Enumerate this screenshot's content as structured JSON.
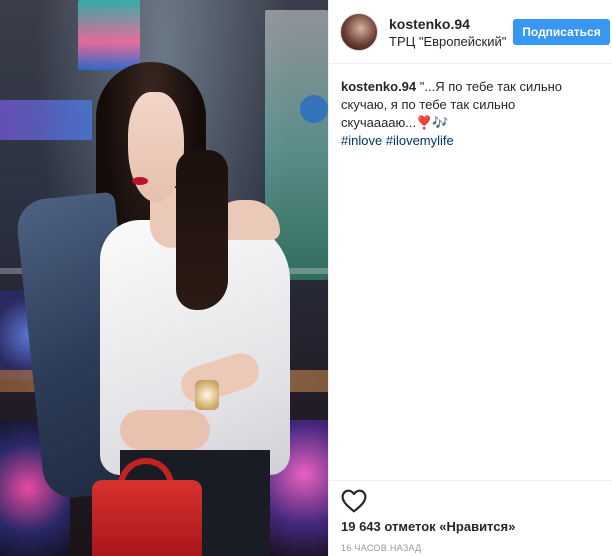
{
  "post": {
    "username": "kostenko.94",
    "location": "ТРЦ \"Европейский\"",
    "follow_label": "Подписаться",
    "caption_user": "kostenko.94",
    "caption_text": "\"...Я по тебе так сильно скучаю, я по тебе так сильно скучааааю...❣️🎶",
    "hashtags": [
      "#inlove",
      "#ilovemylife"
    ],
    "likes": "19 643 отметок «Нравится»",
    "timestamp": "16 ЧАСОВ НАЗАД"
  },
  "icons": {
    "like": "heart-outline-icon",
    "avatar": "profile-avatar"
  },
  "colors": {
    "accent": "#3897f0",
    "hashtag": "#003569",
    "muted": "#999999"
  }
}
